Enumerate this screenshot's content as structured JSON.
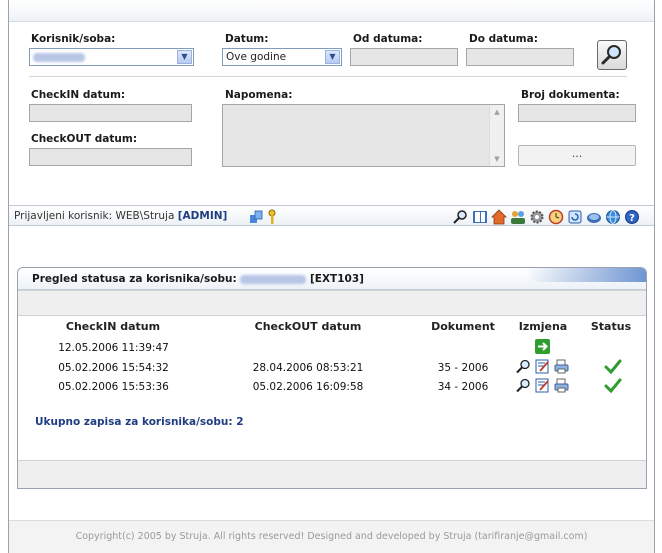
{
  "filters": {
    "korisnik_label": "Korisnik/soba:",
    "datum_label": "Datum:",
    "datum_value": "Ove godine",
    "od_label": "Od datuma:",
    "do_label": "Do datuma:",
    "checkin_label": "CheckIN datum:",
    "checkout_label": "CheckOUT datum:",
    "napomena_label": "Napomena:",
    "broj_label": "Broj dokumenta:",
    "dots_label": "..."
  },
  "statusbar": {
    "prefix": "Prijavljeni korisnik:",
    "user": "WEB\\Struja",
    "role": "[ADMIN]"
  },
  "panel": {
    "title": "Pregled statusa za korisnika/sobu:",
    "code": "[EXT103]",
    "columns": {
      "checkin": "CheckIN datum",
      "checkout": "CheckOUT datum",
      "dokument": "Dokument",
      "izmjena": "Izmjena",
      "status": "Status"
    },
    "rows": [
      {
        "checkin": "12.05.2006 11:39:47",
        "checkout": "",
        "dokument": ""
      },
      {
        "checkin": "05.02.2006 15:54:32",
        "checkout": "28.04.2006 08:53:21",
        "dokument": "35 - 2006"
      },
      {
        "checkin": "05.02.2006 15:53:36",
        "checkout": "05.02.2006 16:09:58",
        "dokument": "34 - 2006"
      }
    ],
    "total": "Ukupno zapisa za korisnika/sobu: 2"
  },
  "footer": {
    "text": "Copyright(c) 2005 by Struja. All rights reserved! Designed and developed by Struja (tarifiranje@gmail.com)"
  },
  "colors": {
    "accent": "#6f96d2",
    "link": "#1f3d80",
    "check": "#2e9d2e"
  }
}
